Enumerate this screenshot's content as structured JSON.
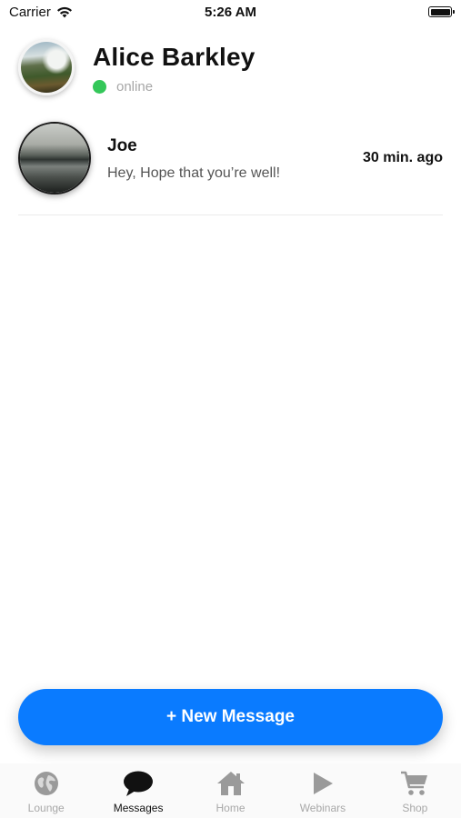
{
  "status_bar": {
    "carrier": "Carrier",
    "time": "5:26 AM",
    "wifi_icon": "wifi-icon",
    "battery_icon": "battery-icon"
  },
  "profile": {
    "name": "Alice Barkley",
    "status": "online",
    "status_color": "#34c759",
    "avatar_icon": "waterfall-photo"
  },
  "conversations": [
    {
      "name": "Joe",
      "preview": "Hey, Hope that you’re well!",
      "time": "30 min. ago",
      "avatar_icon": "lake-photo"
    }
  ],
  "new_message_button": {
    "label": "+ New Message",
    "color": "#0a7bff"
  },
  "tab_bar": {
    "active_color": "#111111",
    "inactive_color": "#a8a8a8",
    "tabs": [
      {
        "label": "Lounge",
        "icon": "globe-icon",
        "active": false
      },
      {
        "label": "Messages",
        "icon": "chat-bubble-icon",
        "active": true
      },
      {
        "label": "Home",
        "icon": "house-icon",
        "active": false
      },
      {
        "label": "Webinars",
        "icon": "play-icon",
        "active": false
      },
      {
        "label": "Shop",
        "icon": "cart-icon",
        "active": false
      }
    ]
  }
}
